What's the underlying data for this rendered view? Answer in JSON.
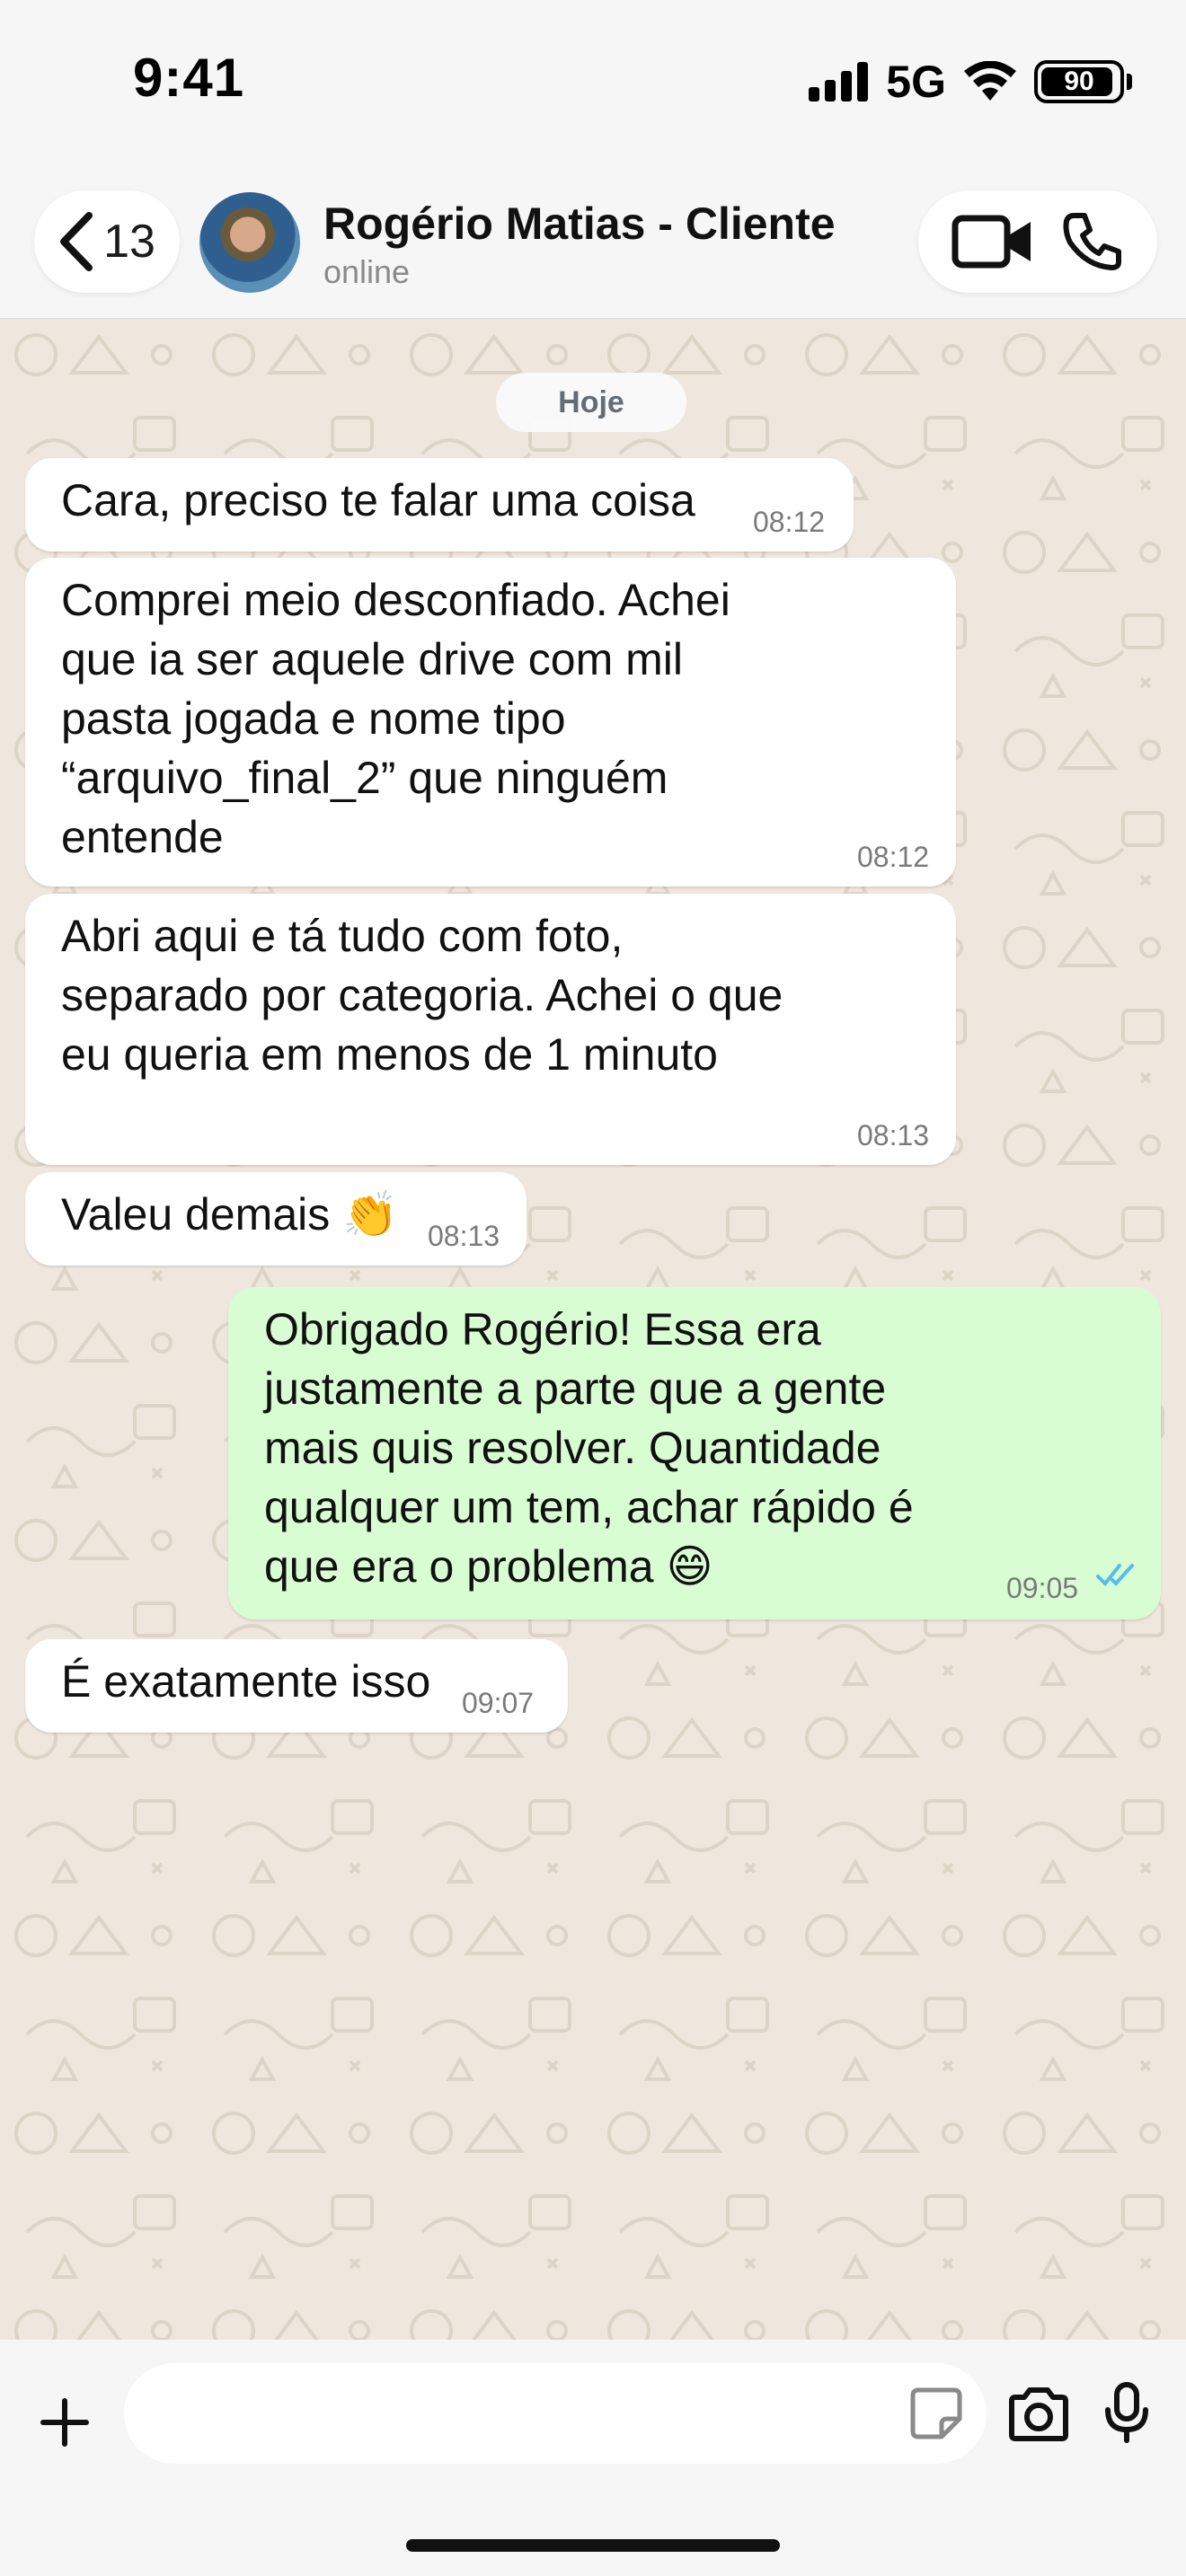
{
  "status_bar": {
    "time": "9:41",
    "network": "5G",
    "battery": "90"
  },
  "header": {
    "back_count": "13",
    "contact_name": "Rogério Matias - Cliente",
    "contact_status": "online"
  },
  "chat": {
    "date_label": "Hoje",
    "messages": [
      {
        "direction": "in",
        "text": "Cara, preciso te falar uma coisa",
        "time": "08:12"
      },
      {
        "direction": "in",
        "text": "Comprei meio desconfiado. Achei\nque ia ser aquele drive com mil\npasta jogada e nome tipo\n“arquivo_final_2” que ninguém\nentende",
        "time": "08:12"
      },
      {
        "direction": "in",
        "text": "Abri aqui e tá tudo com foto,\nseparado por categoria. Achei o que\neu queria em menos de 1 minuto",
        "time": "08:13"
      },
      {
        "direction": "in",
        "text": "Valeu demais 👏",
        "time": "08:13"
      },
      {
        "direction": "out",
        "text": "Obrigado Rogério! Essa era\njustamente a parte que a gente\nmais quis resolver. Quantidade\nqualquer um tem, achar rápido é\nque era o problema 😄",
        "time": "09:05",
        "read": true
      },
      {
        "direction": "in",
        "text": "É exatamente isso",
        "time": "09:07"
      }
    ]
  },
  "input": {
    "placeholder": ""
  },
  "colors": {
    "chat_background": "#efe7de",
    "incoming_bubble": "#ffffff",
    "outgoing_bubble": "#d9fdd3",
    "read_ticks": "#53bdeb"
  },
  "icons": [
    "signal-icon",
    "wifi-icon",
    "battery-icon",
    "back-chevron-icon",
    "video-call-icon",
    "phone-icon",
    "plus-icon",
    "sticker-icon",
    "camera-icon",
    "mic-icon",
    "double-check-icon"
  ]
}
